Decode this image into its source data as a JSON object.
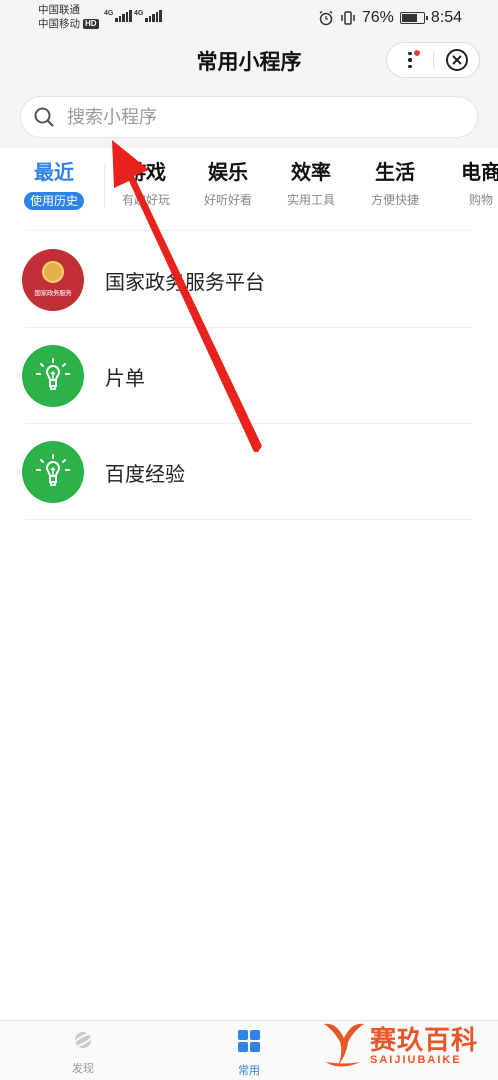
{
  "status_bar": {
    "carrier1": "中国联通",
    "carrier2": "中国移动",
    "hd_badge": "HD",
    "network1": "4G",
    "network2": "4G",
    "battery_percent": "76%",
    "battery_level": 0.76,
    "time": "8:54"
  },
  "header": {
    "title": "常用小程序",
    "search_placeholder": "搜索小程序"
  },
  "tabs": [
    {
      "title": "最近",
      "subtitle": "使用历史"
    },
    {
      "title": "游戏",
      "subtitle": "有趣好玩"
    },
    {
      "title": "娱乐",
      "subtitle": "好听好看"
    },
    {
      "title": "效率",
      "subtitle": "实用工具"
    },
    {
      "title": "生活",
      "subtitle": "方便快捷"
    },
    {
      "title": "电商",
      "subtitle": "购物"
    }
  ],
  "list": [
    {
      "name": "国家政务服务平台",
      "icon": "gov-emblem-icon",
      "icon_caption": "国家政务服务"
    },
    {
      "name": "片单",
      "icon": "lightbulb-icon"
    },
    {
      "name": "百度经验",
      "icon": "lightbulb-icon"
    }
  ],
  "bottom_nav": [
    {
      "label": "发现",
      "icon": "planet-icon"
    },
    {
      "label": "常用",
      "icon": "grid-icon"
    }
  ],
  "watermark": {
    "text": "赛玖百科",
    "sub": "SAIJIUBAIKE"
  },
  "colors": {
    "accent": "#2f82e6",
    "gov_red": "#c12f37",
    "bulb_green": "#2db24a",
    "arrow_red": "#e8231e"
  }
}
